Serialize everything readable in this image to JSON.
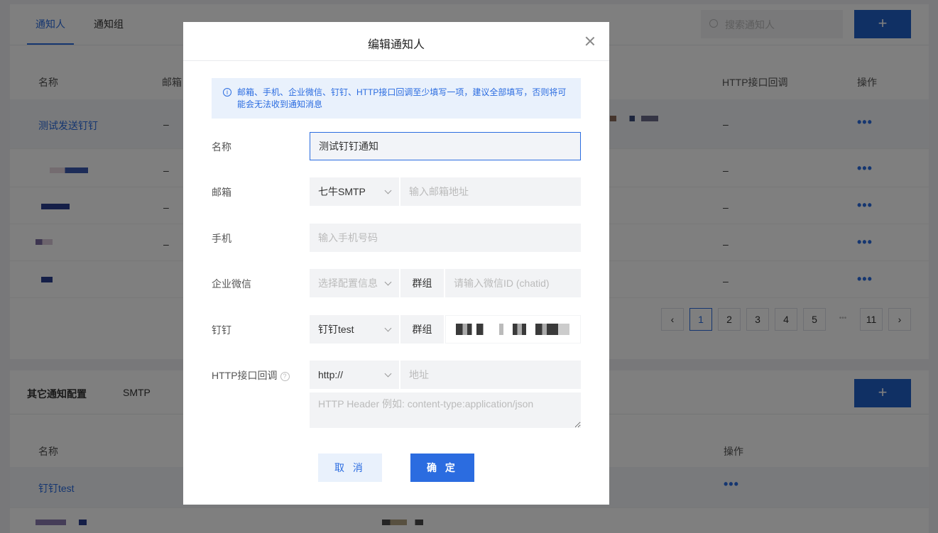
{
  "background": {
    "tabs": [
      "通知人",
      "通知组"
    ],
    "search_placeholder": "搜索通知人",
    "add_label": "+",
    "table1": {
      "headers": [
        "名称",
        "邮箱",
        "HTTP接口回调",
        "操作"
      ],
      "rows": [
        {
          "name": "测试发送钉钉",
          "email": "–",
          "http": "–"
        },
        {
          "name": "",
          "email": "–",
          "http": "–"
        },
        {
          "name": "",
          "email": "–",
          "http": "–"
        },
        {
          "name": "",
          "email": "–",
          "http": "–"
        },
        {
          "name": "",
          "email": "",
          "http": "–"
        }
      ],
      "actions": "•••"
    },
    "pagination": {
      "prev": "‹",
      "pages": [
        "1",
        "2",
        "3",
        "4",
        "5"
      ],
      "ellipsis": "•••",
      "last": "11",
      "next": "›",
      "current": "1"
    },
    "section2": {
      "tabs": [
        "其它通知配置",
        "SMTP"
      ],
      "headers": [
        "名称",
        "操作"
      ],
      "rows": [
        {
          "name": "钉钉test"
        }
      ],
      "actions": "•••"
    }
  },
  "modal": {
    "title": "编辑通知人",
    "notice": "邮箱、手机、企业微信、钉钉、HTTP接口回调至少填写一项，建议全部填写，否则将可能会无法收到通知消息",
    "name": {
      "label": "名称",
      "value": "测试钉钉通知"
    },
    "email": {
      "label": "邮箱",
      "provider": "七牛SMTP",
      "placeholder": "输入邮箱地址"
    },
    "phone": {
      "label": "手机",
      "placeholder": "输入手机号码"
    },
    "wecom": {
      "label": "企业微信",
      "config_placeholder": "选择配置信息",
      "addon": "群组",
      "placeholder": "请输入微信ID (chatid)"
    },
    "dingtalk": {
      "label": "钉钉",
      "config": "钉钉test",
      "addon": "群组"
    },
    "http": {
      "label": "HTTP接口回调",
      "protocol": "http://",
      "address_placeholder": "地址",
      "header_placeholder": "HTTP Header 例如: content-type:application/json"
    },
    "cancel_label": "取 消",
    "ok_label": "确 定"
  }
}
